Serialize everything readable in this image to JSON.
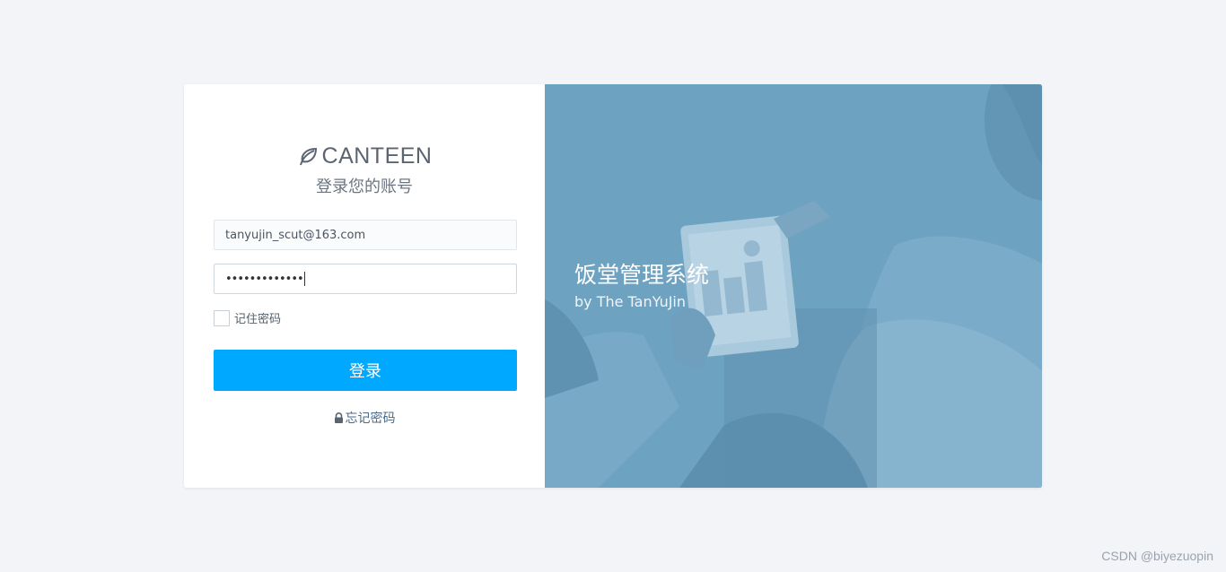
{
  "brand": {
    "logo_text": "CANTEEN",
    "subtitle": "登录您的账号"
  },
  "form": {
    "username_value": "tanyujin_scut@163.com",
    "password_mask": "•••••••••••••",
    "remember_label": "记住密码",
    "remember_checked": false,
    "login_label": "登录",
    "forgot_label": "忘记密码"
  },
  "hero": {
    "title": "饭堂管理系统",
    "subtitle": "by The TanYuJin"
  },
  "watermark": "CSDN @biyezuopin",
  "colors": {
    "page_bg": "#f2f4f8",
    "primary_button": "#00a8ff",
    "hero_overlay": "#6ea2c1"
  },
  "icons": {
    "logo": "leaf-icon",
    "forgot": "lock-icon"
  }
}
